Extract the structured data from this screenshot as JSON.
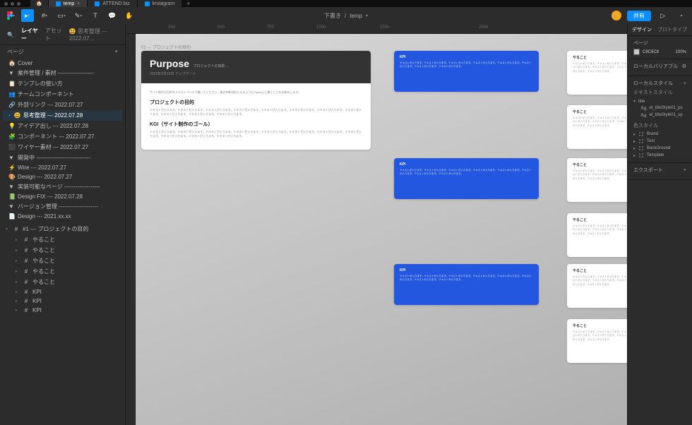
{
  "tabs": [
    {
      "label": "temp",
      "active": true,
      "close": true
    },
    {
      "label": "ATTEND biz",
      "active": false
    },
    {
      "label": "krutagram",
      "active": false
    }
  ],
  "titlebar": {
    "status": "下書き",
    "filename": "temp"
  },
  "toolbar_right": {
    "share": "共有"
  },
  "left": {
    "tab_layers": "レイヤー",
    "tab_assets": "アセット",
    "dropdown": "😃 思考整理 --- 2022.07...",
    "pages_label": "ページ",
    "pages": [
      {
        "ico": "🏠",
        "label": "Cover"
      },
      {
        "ico": "▼",
        "label": "案件管理 / 素材 -------------------",
        "group": true
      },
      {
        "ico": "📋",
        "label": "テンプレの使い方"
      },
      {
        "ico": "👥",
        "label": "チームコンポーネント"
      },
      {
        "ico": "🔗",
        "label": "外部リンク --- 2022.07.27"
      },
      {
        "ico": "😃",
        "label": "思考整理 --- 2022.07.28",
        "sel": true,
        "bullet": true
      },
      {
        "ico": "💡",
        "label": "アイデア出し --- 2022.07.28"
      },
      {
        "ico": "🧩",
        "label": "コンポーネント --- 2022.07.27"
      },
      {
        "ico": "⬛",
        "label": "ワイヤー素材 --- 2022.07.27"
      },
      {
        "ico": "▼",
        "label": "開発中 -----------------------------",
        "group": true
      },
      {
        "ico": "⚡",
        "label": "Wire --- 2022.07.27"
      },
      {
        "ico": "🎨",
        "label": "Design --- 2022.07.27"
      },
      {
        "ico": "▼",
        "label": "実装可能なページ -------------------",
        "group": true
      },
      {
        "ico": "📗",
        "label": "Design FIX --- 2022.07.28"
      },
      {
        "ico": "▼",
        "label": "バージョン管理 ---------------------",
        "group": true
      },
      {
        "ico": "📄",
        "label": "Design --- 2021.xx.xx"
      }
    ],
    "layers_root": "#1 --- プロジェクトの目的",
    "layers": [
      "やること",
      "やること",
      "やること",
      "やること",
      "やること",
      "KPI",
      "KPI",
      "KPI"
    ]
  },
  "canvas": {
    "frame_label": "01 --- プロジェクトの目的",
    "purpose": {
      "title": "Purpose",
      "sub": "プロジェクトの目的 ...",
      "date": "2022年2月15日 アップデート",
      "intro": "サイト制作の目的をテキストベースで書いてください。後の判断材料になるようにFigma上に書くことをお勧めします。",
      "h1": "プロジェクトの目的",
      "body1": "テキストが入ります。テキストが入ります。テキストが入ります。テキストが入ります。テキストが入ります。テキストが入ります。テキストが入ります。テキストが入ります。テキストが入ります。テキストが入ります。テキストが入ります。",
      "h2": "KGI（サイト制作のゴール）",
      "body2": "テキストが入ります。テキストが入ります。テキストが入ります。テキストが入ります。テキストが入ります。テキストが入ります。テキストが入ります。テキストが入ります。テキストが入ります。テキストが入ります。テキストが入ります。"
    },
    "kpi_label": "KPI",
    "todo_label": "やること",
    "filler": "テキストが入ります。テキストが入ります。テキストが入ります。テキストが入ります。テキストが入ります。テキストが入ります。テキストが入ります。テキストが入ります。"
  },
  "right": {
    "tab_design": "デザイン",
    "tab_proto": "プロトタイプ",
    "page_label": "ページ",
    "bg_hex": "C8C8C8",
    "bg_pct": "100%",
    "local_vars": "ローカルバリアブル",
    "local_styles": "ローカルスタイル",
    "text_styles": "テキストスタイル",
    "ts_group": "title",
    "ts1": "el_titleStyle01_pc",
    "ts2": "el_titleStyle01_sp",
    "color_styles": "色スタイル",
    "cs": [
      "Brand",
      "Text",
      "BackGround",
      "Template"
    ],
    "export": "エクスポート"
  }
}
